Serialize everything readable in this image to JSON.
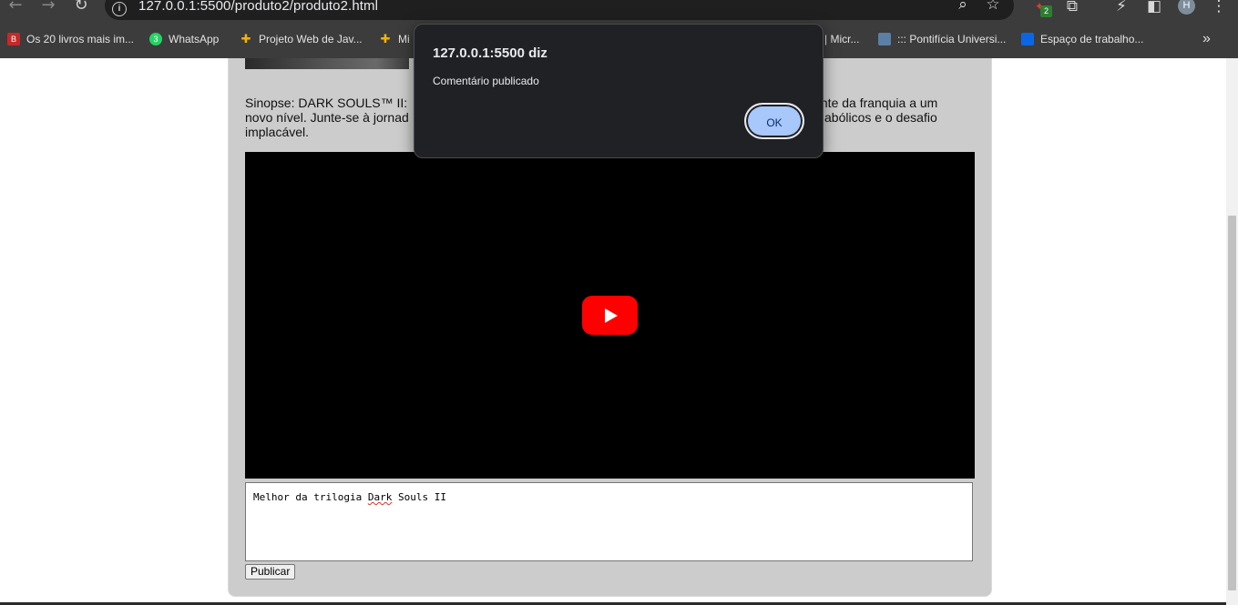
{
  "browser": {
    "url": "127.0.0.1:5500/produto2/produto2.html",
    "avatar_letter": "H",
    "extension_badge": "2",
    "bookmarks": [
      {
        "label": "Os 20 livros mais im...",
        "icon_text": "B",
        "color": "#c62828"
      },
      {
        "label": "WhatsApp",
        "icon_text": "3",
        "color": "#25d366"
      },
      {
        "label": "Projeto Web de Jav...",
        "icon_text": "",
        "color": "#f4b400"
      },
      {
        "label": "Mi",
        "icon_text": "",
        "color": "#f4b400"
      },
      {
        "label": "| Micr...",
        "icon_text": "",
        "color": "#3c3c3c"
      },
      {
        "label": "::: Pontifícia Universi...",
        "icon_text": "",
        "color": "#5b7fa6"
      },
      {
        "label": "Espaço de trabalho...",
        "icon_text": "",
        "color": "#0c66e4"
      }
    ]
  },
  "page": {
    "sinopse_left": "Sinopse: DARK SOULS™ II:",
    "sinopse_right": "ciante da franquia a um",
    "sinopse_line2_left": "novo nível. Junte-se à jornad",
    "sinopse_line2_right": "abólicos e o desafio",
    "sinopse_line3": "implacável.",
    "comment_text_before": "Melhor da trilogia ",
    "comment_text_misspelled": "Dark",
    "comment_text_after": " Souls II",
    "publish_label": "Publicar"
  },
  "dialog": {
    "title": "127.0.0.1:5500 diz",
    "message": "Comentário publicado",
    "ok_label": "OK"
  },
  "colors": {
    "youtube_red": "#ff0000",
    "dialog_button": "#a8c7fa",
    "card_background": "#cccccc"
  }
}
